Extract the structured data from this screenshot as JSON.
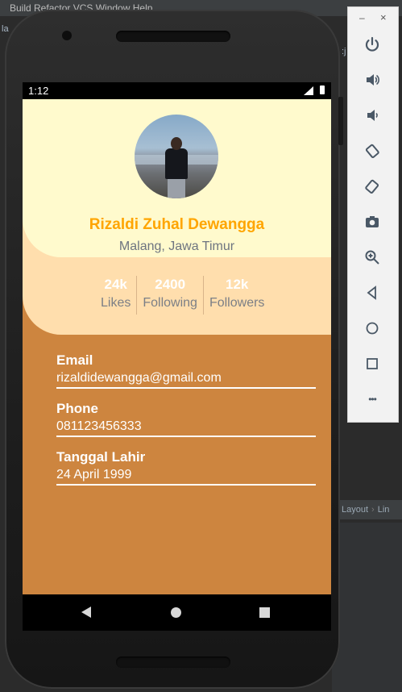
{
  "ide": {
    "menu": "Build  Refactor  VCS  Window  Help",
    "side_text_1": "la",
    "side_text_2": ":j",
    "breadcrumb_1": "Layout",
    "breadcrumb_2": "Lin"
  },
  "status_bar": {
    "time": "1:12"
  },
  "profile": {
    "name": "Rizaldi Zuhal Dewangga",
    "location": "Malang, Jawa Timur"
  },
  "stats": [
    {
      "value": "24k",
      "label": "Likes"
    },
    {
      "value": "2400",
      "label": "Following"
    },
    {
      "value": "12k",
      "label": "Followers"
    }
  ],
  "info": {
    "email_label": "Email",
    "email_value": "rizaldidewangga@gmail.com",
    "phone_label": "Phone",
    "phone_value": "081123456333",
    "dob_label": "Tanggal Lahir",
    "dob_value": "24 April 1999"
  },
  "toolbar": {
    "minimize": "–",
    "close": "×",
    "more": "•••"
  },
  "colors": {
    "header_bg": "#fffacd",
    "stats_bg": "#ffdead",
    "body_bg": "#cd853f",
    "name_color": "#ffa500"
  }
}
